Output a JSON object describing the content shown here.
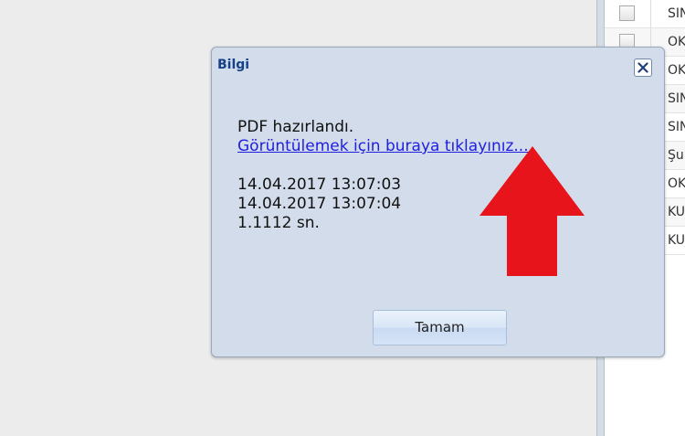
{
  "dialog": {
    "title": "Bilgi",
    "close_icon": "close-icon",
    "message": "PDF hazırlandı.",
    "link_text": "Görüntülemek için buraya tıklayınız...",
    "start_time": "14.04.2017 13:07:03",
    "end_time": "14.04.2017 13:07:04",
    "duration": "1.1112 sn.",
    "ok_label": "Tamam"
  },
  "annotation": {
    "arrow_icon": "red-arrow-up-icon",
    "arrow_color": "#e8141b"
  },
  "grid": {
    "rows": [
      {
        "text": "SIN"
      },
      {
        "text": "OK"
      },
      {
        "text": "OK"
      },
      {
        "text": "SIN"
      },
      {
        "text": "SIN"
      },
      {
        "text": "Şu"
      },
      {
        "text": "OK"
      },
      {
        "text": "KU"
      },
      {
        "text": "KU"
      }
    ]
  },
  "colors": {
    "dialog_bg": "#d2dcea",
    "title_color": "#15428b",
    "link_color": "#2020e0"
  }
}
